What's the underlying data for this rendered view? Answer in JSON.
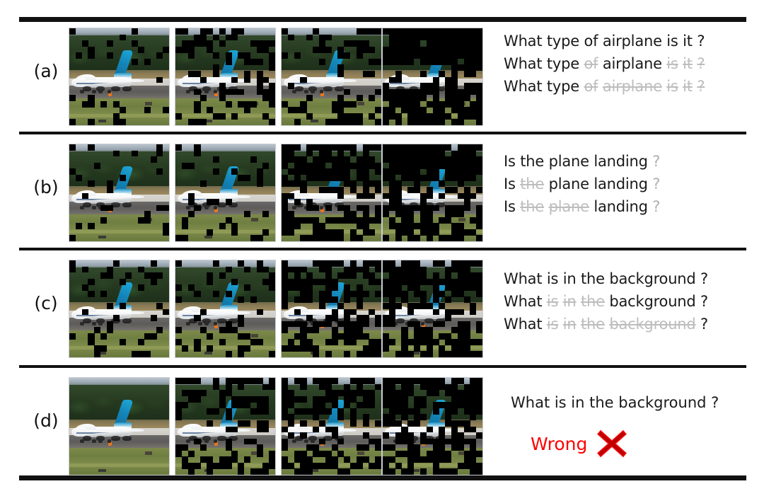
{
  "figure": {
    "caption_rows": [
      "(a)",
      "(b)",
      "(c)",
      "(d)"
    ],
    "columns": 4,
    "colors": {
      "rule": "#111111",
      "faded_word": "#bdbdbd",
      "active_word": "#1a1a1a",
      "wrong_text": "#ff0000",
      "wrong_x": "#c00000",
      "tail_fin": "#1487bb",
      "fuselage": "#ffffff",
      "trees": "#263a20",
      "grass": "#6f7f41",
      "tarmac": "#5d5c5a",
      "mask": "#000000"
    }
  },
  "rows": [
    {
      "label": "(a)",
      "name": "row-a",
      "mask_levels": [
        0.12,
        0.3,
        0.34,
        0.78
      ],
      "questions": [
        {
          "words": [
            {
              "text": "What",
              "state": "active"
            },
            {
              "text": "type",
              "state": "active"
            },
            {
              "text": "of",
              "state": "active"
            },
            {
              "text": "airplane",
              "state": "active"
            },
            {
              "text": "is",
              "state": "active"
            },
            {
              "text": "it",
              "state": "active"
            },
            {
              "text": "?",
              "state": "active"
            }
          ]
        },
        {
          "words": [
            {
              "text": "What",
              "state": "active"
            },
            {
              "text": "type",
              "state": "active"
            },
            {
              "text": "of",
              "state": "faded"
            },
            {
              "text": "airplane",
              "state": "active"
            },
            {
              "text": "is",
              "state": "faded"
            },
            {
              "text": "it",
              "state": "faded"
            },
            {
              "text": "?",
              "state": "faded"
            }
          ]
        },
        {
          "words": [
            {
              "text": "What",
              "state": "active"
            },
            {
              "text": "type",
              "state": "active"
            },
            {
              "text": "of",
              "state": "faded"
            },
            {
              "text": "airplane",
              "state": "faded"
            },
            {
              "text": "is",
              "state": "faded"
            },
            {
              "text": "it",
              "state": "faded"
            },
            {
              "text": "?",
              "state": "faded"
            }
          ]
        }
      ]
    },
    {
      "label": "(b)",
      "name": "row-b",
      "mask_levels": [
        0.1,
        0.16,
        0.62,
        0.74
      ],
      "questions": [
        {
          "words": [
            {
              "text": "Is",
              "state": "active"
            },
            {
              "text": "the",
              "state": "active"
            },
            {
              "text": "plane",
              "state": "active"
            },
            {
              "text": "landing",
              "state": "active"
            },
            {
              "text": "?",
              "state": "dim"
            }
          ]
        },
        {
          "words": [
            {
              "text": "Is",
              "state": "active"
            },
            {
              "text": "the",
              "state": "faded"
            },
            {
              "text": "plane",
              "state": "active"
            },
            {
              "text": "landing",
              "state": "active"
            },
            {
              "text": "?",
              "state": "dim"
            }
          ]
        },
        {
          "words": [
            {
              "text": "Is",
              "state": "active"
            },
            {
              "text": "the",
              "state": "faded"
            },
            {
              "text": "plane",
              "state": "faded"
            },
            {
              "text": "landing",
              "state": "active"
            },
            {
              "text": "?",
              "state": "dim"
            }
          ]
        }
      ]
    },
    {
      "label": "(c)",
      "name": "row-c",
      "mask_levels": [
        0.14,
        0.2,
        0.52,
        0.7
      ],
      "questions": [
        {
          "words": [
            {
              "text": "What",
              "state": "active"
            },
            {
              "text": "is",
              "state": "active"
            },
            {
              "text": "in",
              "state": "active"
            },
            {
              "text": "the",
              "state": "active"
            },
            {
              "text": "background",
              "state": "active"
            },
            {
              "text": "?",
              "state": "active"
            }
          ]
        },
        {
          "words": [
            {
              "text": "What",
              "state": "active"
            },
            {
              "text": "is",
              "state": "faded"
            },
            {
              "text": "in",
              "state": "faded"
            },
            {
              "text": "the",
              "state": "faded"
            },
            {
              "text": "background",
              "state": "active"
            },
            {
              "text": "?",
              "state": "active"
            }
          ]
        },
        {
          "words": [
            {
              "text": "What",
              "state": "active"
            },
            {
              "text": "is",
              "state": "faded"
            },
            {
              "text": "in",
              "state": "faded"
            },
            {
              "text": "the",
              "state": "faded"
            },
            {
              "text": "background",
              "state": "faded"
            },
            {
              "text": "?",
              "state": "active"
            }
          ]
        }
      ]
    },
    {
      "label": "(d)",
      "name": "row-d",
      "mask_levels": [
        0.0,
        0.3,
        0.5,
        0.6
      ],
      "question_text": "What is in the background ?",
      "verdict_label": "Wrong",
      "verdict_icon": "x-mark-icon"
    }
  ]
}
